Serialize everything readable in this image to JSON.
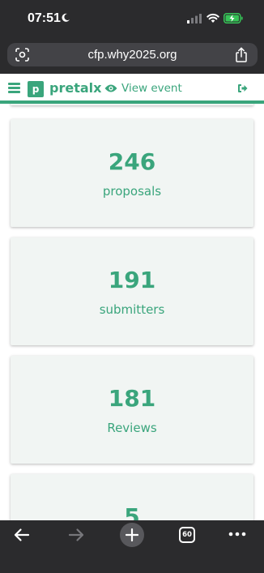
{
  "status_bar": {
    "time": "07:51",
    "icons": [
      "moon-icon",
      "cellular-signal-icon",
      "wifi-icon",
      "battery-charging-icon"
    ]
  },
  "browser": {
    "url": "cfp.why2025.org",
    "icons": [
      "page-scan-icon",
      "share-icon"
    ]
  },
  "header": {
    "logo_letter": "p",
    "brand": "pretalx",
    "view_event_label": "View event",
    "icons": [
      "menu-icon",
      "eye-icon",
      "logout-icon"
    ],
    "accent_color": "#3aa57c"
  },
  "stats": [
    {
      "value": "246",
      "label": "proposals"
    },
    {
      "value": "191",
      "label": "submitters"
    },
    {
      "value": "181",
      "label": "Reviews"
    },
    {
      "value": "5",
      "label": ""
    }
  ],
  "bottom_toolbar": {
    "tab_count": "60",
    "icons": [
      "back-arrow-icon",
      "forward-arrow-icon",
      "plus-icon",
      "tabs-icon",
      "more-icon"
    ]
  },
  "colors": {
    "chrome_background": "#2b2b2d",
    "card_background": "#f1f5f3",
    "accent": "#3aa57c"
  }
}
